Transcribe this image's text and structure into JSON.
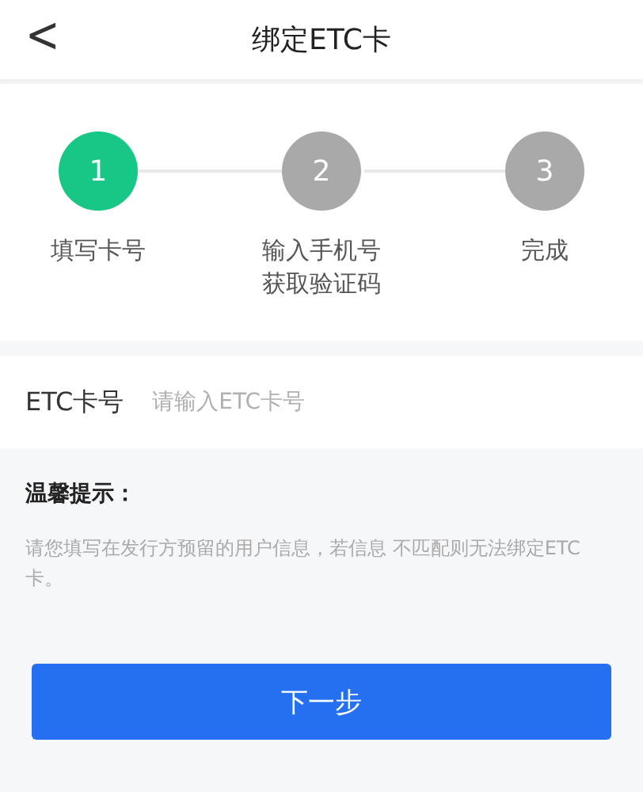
{
  "header": {
    "back_icon": "<",
    "title": "绑定ETC卡"
  },
  "steps": [
    {
      "number": "1",
      "label": [
        "填写卡号"
      ],
      "active": true
    },
    {
      "number": "2",
      "label": [
        "输入手机号",
        "获取验证码"
      ],
      "active": false
    },
    {
      "number": "3",
      "label": [
        "完成"
      ],
      "active": false
    }
  ],
  "card_field": {
    "label": "ETC卡号",
    "placeholder": "请输入ETC卡号"
  },
  "tips": {
    "title": "温馨提示：",
    "text": "请您填写在发行方预留的用户信息，若信息 不匹配则无法绑定ETC卡。"
  },
  "next_button": "下一步"
}
